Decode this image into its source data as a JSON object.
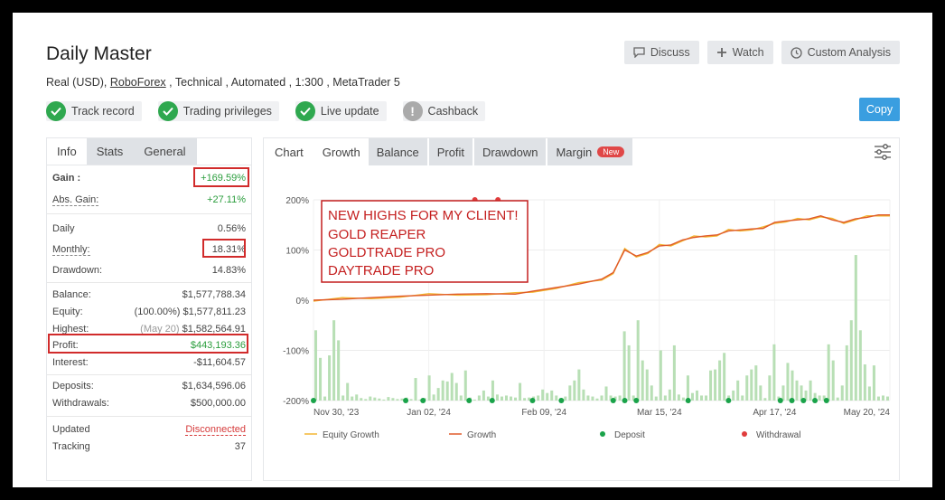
{
  "header": {
    "title": "Daily Master",
    "subtitle_pre": "Real (USD), ",
    "broker": "RoboForex",
    "subtitle_post": " , Technical , Automated , 1:300 , MetaTrader 5",
    "buttons": {
      "discuss": "Discuss",
      "watch": "Watch",
      "custom_analysis": "Custom Analysis"
    },
    "copy": "Copy"
  },
  "badges": [
    {
      "label": "Track record",
      "icon": "check-icon"
    },
    {
      "label": "Trading privileges",
      "icon": "check-icon"
    },
    {
      "label": "Live update",
      "icon": "check-icon"
    },
    {
      "label": "Cashback",
      "icon": "exclamation-icon"
    }
  ],
  "left_tabs": [
    "Info",
    "Stats",
    "General"
  ],
  "stats": {
    "gain": {
      "label": "Gain :",
      "value": "+169.59%"
    },
    "abs_gain": {
      "label": "Abs. Gain:",
      "value": "+27.11%"
    },
    "daily": {
      "label": "Daily",
      "value": "0.56%"
    },
    "monthly": {
      "label": "Monthly:",
      "value": "18.31%"
    },
    "drawdown": {
      "label": "Drawdown:",
      "value": "14.83%"
    },
    "balance": {
      "label": "Balance:",
      "value": "$1,577,788.34"
    },
    "equity": {
      "label": "Equity:",
      "note": "(100.00%)",
      "value": "$1,577,811.23"
    },
    "highest": {
      "label": "Highest:",
      "note": "(May 20)",
      "value": "$1,582,564.91"
    },
    "profit": {
      "label": "Profit:",
      "value": "$443,193.36"
    },
    "interest": {
      "label": "Interest:",
      "value": "-$11,604.57"
    },
    "deposits": {
      "label": "Deposits:",
      "value": "$1,634,596.06"
    },
    "withdrawals": {
      "label": "Withdrawals:",
      "value": "$500,000.00"
    },
    "updated": {
      "label": "Updated",
      "value": "Disconnected"
    },
    "tracking": {
      "label": "Tracking",
      "value": "37"
    }
  },
  "chart_tabs": {
    "chart": "Chart",
    "tabs": [
      "Growth",
      "Balance",
      "Profit",
      "Drawdown",
      "Margin"
    ],
    "new_tag": "New"
  },
  "annotation": [
    "NEW HIGHS FOR MY CLIENT!",
    "GOLD REAPER",
    "GOLDTRADE PRO",
    "DAYTRADE PRO"
  ],
  "colors": {
    "growth": "#e05a2a",
    "equity": "#f2b632",
    "deposit": "#1aa34a",
    "withdrawal": "#e03c3c",
    "bars": "#b8dfb5",
    "accent": "#3a9ee0"
  },
  "chart_data": {
    "type": "line",
    "yticks": [
      "200%",
      "100%",
      "0%",
      "-100%",
      "-200%"
    ],
    "ylim": [
      -200,
      200
    ],
    "xticks": [
      "Nov 30, '23",
      "Jan 02, '24",
      "Feb 09, '24",
      "Mar 15, '24",
      "Apr 17, '24",
      "May 20, '24"
    ],
    "legend": [
      "Equity Growth",
      "Growth",
      "Deposit",
      "Withdrawal"
    ],
    "x": [
      0,
      0.05,
      0.1,
      0.15,
      0.2,
      0.25,
      0.3,
      0.35,
      0.38,
      0.42,
      0.46,
      0.5,
      0.52,
      0.54,
      0.56,
      0.58,
      0.6,
      0.62,
      0.64,
      0.66,
      0.68,
      0.7,
      0.72,
      0.74,
      0.76,
      0.78,
      0.8,
      0.82,
      0.84,
      0.86,
      0.88,
      0.9,
      0.92,
      0.94,
      0.96,
      0.98,
      1.0
    ],
    "growth": [
      0,
      2,
      5,
      8,
      10,
      12,
      13,
      12,
      18,
      25,
      32,
      42,
      55,
      100,
      88,
      95,
      108,
      110,
      120,
      125,
      128,
      130,
      138,
      140,
      142,
      143,
      155,
      158,
      160,
      162,
      168,
      160,
      155,
      162,
      165,
      170,
      170
    ],
    "deposits_x": [
      0.0,
      0.16,
      0.19,
      0.27,
      0.31,
      0.38,
      0.43,
      0.52,
      0.54,
      0.56,
      0.65,
      0.72,
      0.81,
      0.83,
      0.85,
      0.87,
      0.89
    ],
    "withdrawals_x": [
      0.28,
      0.32
    ],
    "bars": [
      140,
      85,
      8,
      90,
      160,
      120,
      10,
      35,
      8,
      12,
      5,
      3,
      8,
      6,
      4,
      2,
      7,
      5,
      3,
      4,
      6,
      3,
      45,
      2,
      5,
      50,
      12,
      25,
      40,
      38,
      55,
      35,
      10,
      60,
      6,
      2,
      10,
      20,
      8,
      40,
      12,
      8,
      10,
      8,
      6,
      35,
      5,
      6,
      8,
      10,
      22,
      15,
      20,
      10,
      5,
      8,
      30,
      40,
      62,
      22,
      10,
      8,
      4,
      10,
      28,
      10,
      8,
      10,
      138,
      110,
      10,
      160,
      80,
      62,
      30,
      8,
      100,
      10,
      22,
      110,
      12,
      6,
      50,
      15,
      20,
      10,
      10,
      60,
      62,
      80,
      95,
      10,
      20,
      40,
      10,
      50,
      62,
      70,
      30,
      5,
      50,
      112,
      8,
      30,
      75,
      60,
      40,
      30,
      20,
      40,
      15,
      10,
      10,
      112,
      80,
      6,
      30,
      110,
      160,
      290,
      140,
      72,
      28,
      70,
      8,
      10,
      8
    ]
  }
}
